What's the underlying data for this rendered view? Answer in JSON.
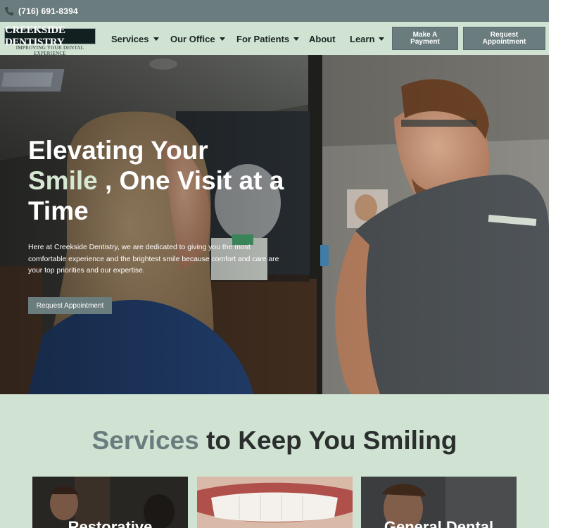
{
  "topbar": {
    "phone": "(716) 691-8394",
    "icon": "phone-icon"
  },
  "logo": {
    "name": "CREEKSIDE DENTISTRY",
    "tagline": "IMPROVING YOUR DENTAL EXPERIENCE"
  },
  "nav": {
    "items": [
      {
        "label": "Services",
        "has_dropdown": true
      },
      {
        "label": "Our Office",
        "has_dropdown": true
      },
      {
        "label": "For Patients",
        "has_dropdown": true
      },
      {
        "label": "About",
        "has_dropdown": false
      },
      {
        "label": "Learn",
        "has_dropdown": true
      }
    ],
    "payment_line1": "Make A",
    "payment_line2": "Payment",
    "appointment_line1": "Request",
    "appointment_line2": "Appointment"
  },
  "hero": {
    "title_part1": "Elevating Your",
    "title_accent": "Smile",
    "title_part2": ", One Visit at a Time",
    "text": "Here at Creekside Dentistry, we are dedicated to giving you the most comfortable experience and the brightest smile because comfort and care are your top priorities and our expertise.",
    "button": "Request Appointment"
  },
  "services": {
    "title_accent": "Services",
    "title_rest": " to Keep You Smiling",
    "cards": [
      {
        "label": "Restorative"
      },
      {
        "label": ""
      },
      {
        "label": "General Dental"
      }
    ]
  },
  "colors": {
    "accent": "#6a7c7e",
    "background": "#d0e3d3",
    "text_dark": "#1a2423",
    "hero_accent": "#d6e8d4"
  }
}
